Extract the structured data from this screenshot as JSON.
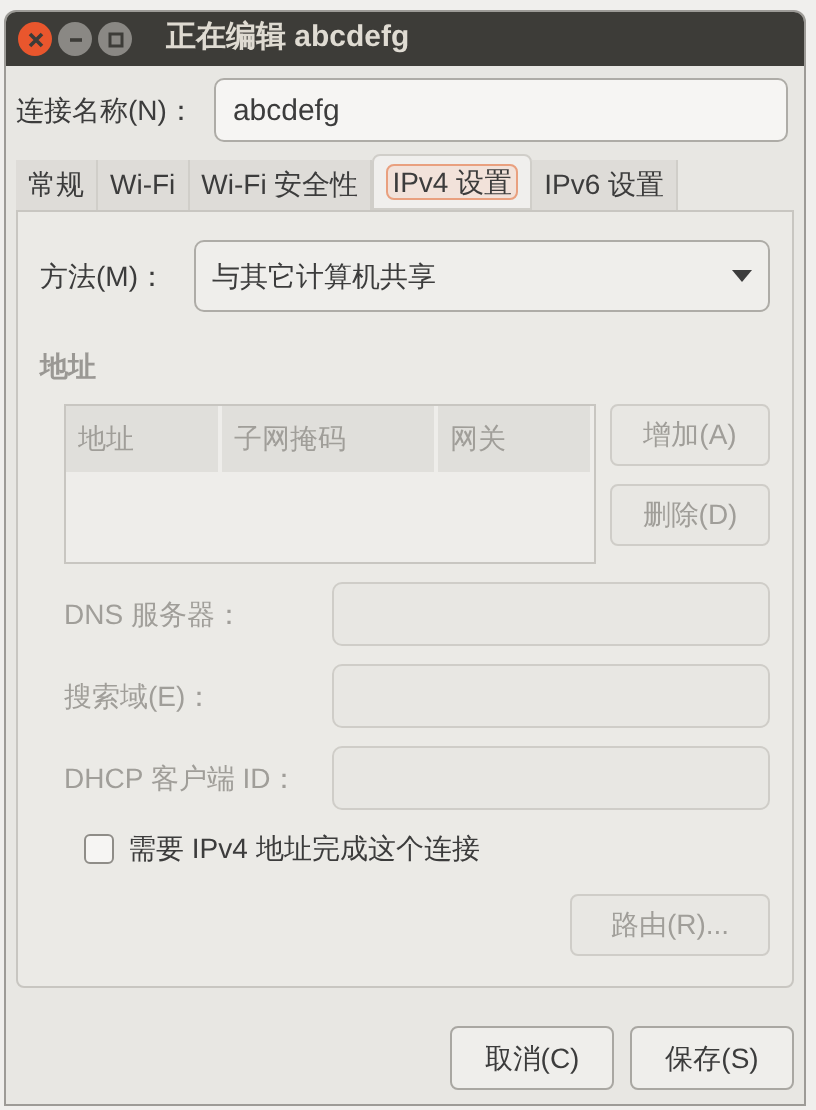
{
  "window": {
    "title": "正在编辑 abcdefg"
  },
  "connection_name": {
    "label": "连接名称(N)：",
    "value": "abcdefg"
  },
  "tabs": [
    {
      "label": "常规",
      "selected": false
    },
    {
      "label": "Wi-Fi",
      "selected": false
    },
    {
      "label": "Wi-Fi 安全性",
      "selected": false
    },
    {
      "label": "IPv4 设置",
      "selected": true
    },
    {
      "label": "IPv6 设置",
      "selected": false
    }
  ],
  "method": {
    "label": "方法(M)：",
    "value": "与其它计算机共享"
  },
  "addresses": {
    "heading": "地址",
    "columns": [
      "地址",
      "子网掩码",
      "网关"
    ],
    "buttons": [
      {
        "label": "增加(A)",
        "disabled": true
      },
      {
        "label": "删除(D)",
        "disabled": true
      }
    ]
  },
  "fields": [
    {
      "label": "DNS 服务器：",
      "disabled": true
    },
    {
      "label": "搜索域(E)：",
      "disabled": true
    },
    {
      "label": "DHCP 客户端 ID：",
      "disabled": true
    }
  ],
  "require_ipv4": {
    "label": "需要 IPv4 地址完成这个连接",
    "checked": false
  },
  "routes_button": {
    "label": "路由(R)...",
    "disabled": true
  },
  "buttons": [
    "取消(C)",
    "保存(S)"
  ]
}
